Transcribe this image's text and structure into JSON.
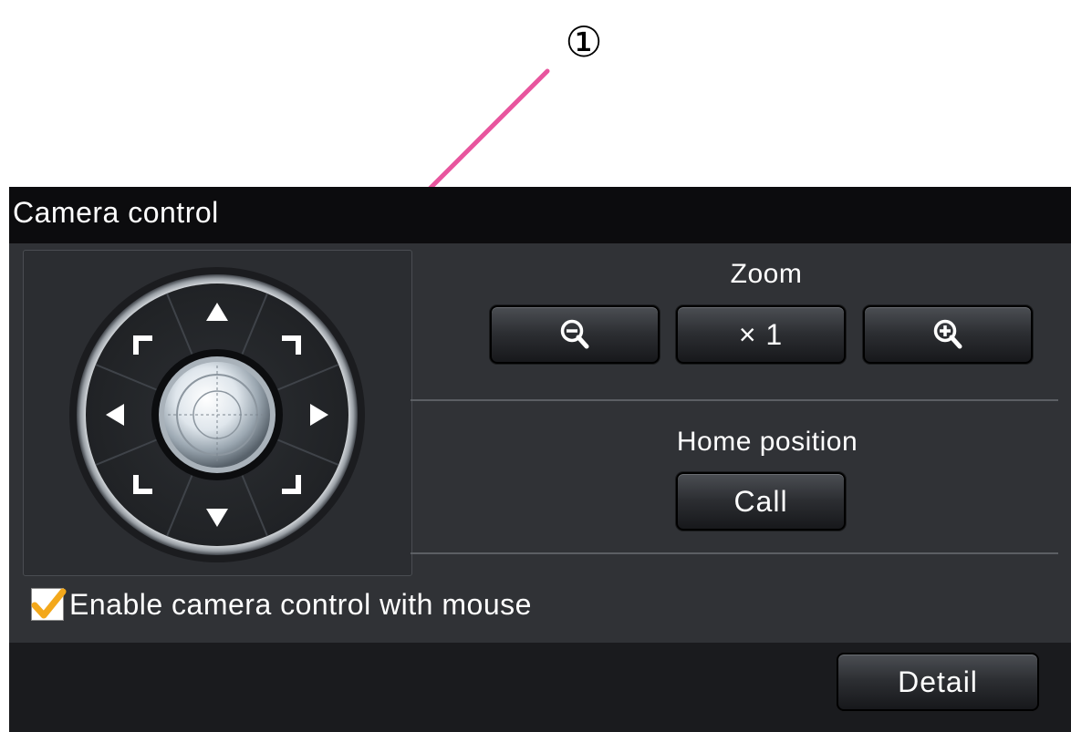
{
  "callout": {
    "number": "①",
    "line_color": "#e8559e"
  },
  "panel": {
    "title": "Camera control",
    "ptz_pad": {
      "directions": [
        "up",
        "up-right",
        "right",
        "down-right",
        "down",
        "down-left",
        "left",
        "up-left"
      ]
    },
    "zoom": {
      "label": "Zoom",
      "zoom_out_icon": "zoom-out-icon",
      "reset_label": "× 1",
      "zoom_in_icon": "zoom-in-icon"
    },
    "home": {
      "label": "Home position",
      "call_label": "Call"
    },
    "mouse_control": {
      "label": "Enable camera control with mouse",
      "checked": true,
      "check_color": "#f3a81b"
    },
    "detail_label": "Detail"
  }
}
